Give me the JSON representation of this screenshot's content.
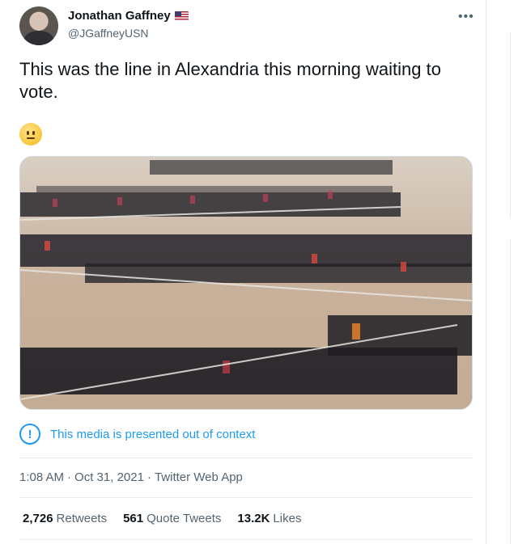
{
  "author": {
    "display_name": "Jonathan Gaffney",
    "handle": "@JGaffneyUSN"
  },
  "tweet": {
    "text": "This was the line in Alexandria this morning waiting to vote.",
    "emoji": "neutral-face"
  },
  "context_notice": {
    "text": "This media is presented out of context",
    "icon": "exclamation-circle-icon",
    "color": "#1d9bf0"
  },
  "meta": {
    "time": "1:08 AM",
    "date": "Oct 31, 2021",
    "source": "Twitter Web App",
    "separator": "·"
  },
  "stats": [
    {
      "value": "2,726",
      "label": "Retweets"
    },
    {
      "value": "561",
      "label": "Quote Tweets"
    },
    {
      "value": "13.2K",
      "label": "Likes"
    }
  ],
  "more_icon": "more-horizontal-icon"
}
